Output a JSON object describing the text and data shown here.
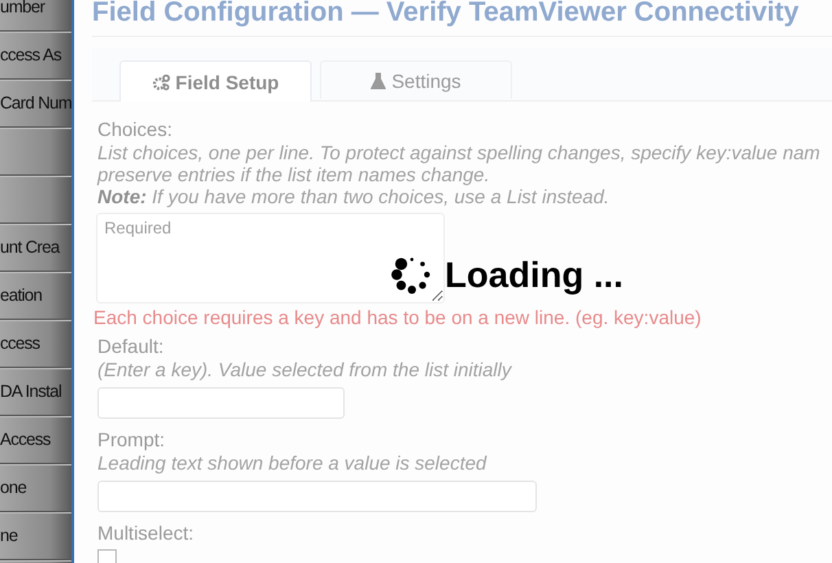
{
  "sidebar": {
    "items_top": [
      "umber",
      "ccess As",
      "Card Num"
    ],
    "items_bottom": [
      "unt Crea",
      "eation",
      "ccess",
      "DA Instal",
      "Access",
      "one",
      "ne"
    ]
  },
  "dialog": {
    "title": "Field Configuration — Verify TeamViewer Connectivity",
    "tabs": [
      {
        "label": "Field Setup",
        "selected": true
      },
      {
        "label": "Settings",
        "selected": false
      }
    ],
    "choices": {
      "label": "Choices:",
      "help": "List choices, one per line. To protect against spelling changes, specify key:value nam",
      "help_2": "preserve entries if the list item names change.",
      "note": "**Note:** If you have more than two choices, use a List instead.",
      "placeholder": "Required",
      "error": "Each choice requires a key and has to be on a new line. (eg. key:value)"
    },
    "default": {
      "label": "Default:",
      "help": "(Enter a key). Value selected from the list initially"
    },
    "prompt": {
      "label": "Prompt:",
      "help": "Leading text shown before a value is selected"
    },
    "multiselect": {
      "label": "Multiselect:",
      "checked": false
    }
  },
  "loading": {
    "text": "Loading ..."
  }
}
